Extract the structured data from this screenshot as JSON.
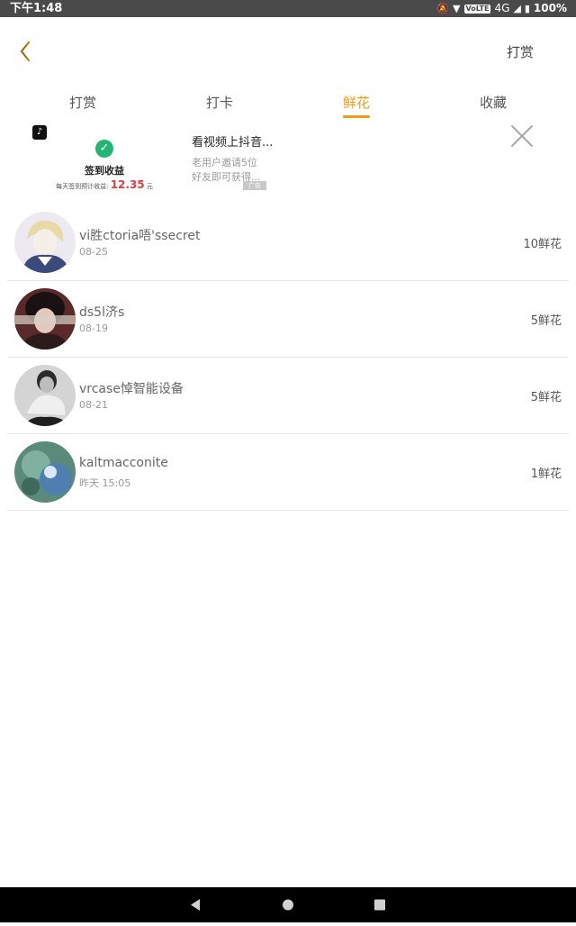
{
  "status_bar": {
    "time": "下午1:48",
    "network": "4G",
    "volte": "VoLTE",
    "battery": "100%"
  },
  "header": {
    "action_label": "打赏"
  },
  "tabs": [
    {
      "label": "打赏",
      "active": false
    },
    {
      "label": "打卡",
      "active": false
    },
    {
      "label": "鲜花",
      "active": true
    },
    {
      "label": "收藏",
      "active": false
    }
  ],
  "ad": {
    "image": {
      "sign_label": "签到收益",
      "income_prefix": "每天签到预计收益:",
      "income_amount": "12.35",
      "income_unit": "元"
    },
    "title": "看视频上抖音...",
    "desc_line1": "老用户邀请5位",
    "desc_line2": "好友即可获得...",
    "tag": "广告"
  },
  "records": [
    {
      "name": "vi胜ctoria唔'ssecret",
      "date": "08-25",
      "flowers": "10鲜花"
    },
    {
      "name": "ds5l济s",
      "date": "08-19",
      "flowers": "5鲜花"
    },
    {
      "name": "vrcase悼智能设备",
      "date": "08-21",
      "flowers": "5鲜花"
    },
    {
      "name": "kaltmacconite",
      "date": "昨天 15:05",
      "flowers": "1鲜花"
    }
  ],
  "colors": {
    "accent": "#f19a14",
    "status_bar": "#4a4a4a",
    "nav_bar": "#000000"
  },
  "icons": {
    "back": "chevron-left-icon",
    "close": "close-icon",
    "nav_back": "triangle-back-icon",
    "nav_home": "circle-home-icon",
    "nav_recent": "square-recent-icon"
  }
}
